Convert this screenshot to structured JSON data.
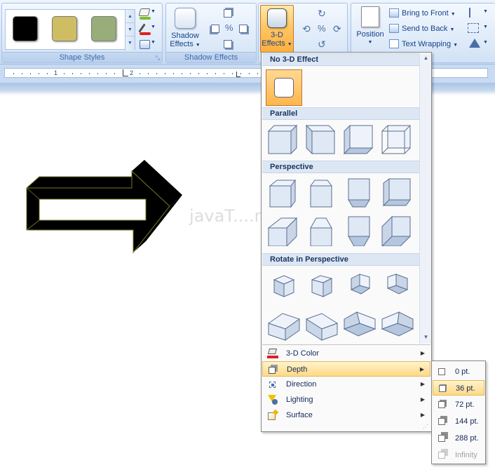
{
  "ribbon": {
    "shape_styles": {
      "label": "Shape Styles",
      "swatches": [
        "#000000",
        "#cfbd63",
        "#98ad7a"
      ]
    },
    "shadow_effects": {
      "button_label_1": "Shadow",
      "button_label_2": "Effects",
      "group_label": "Shadow Effects"
    },
    "three_d": {
      "button_label_1": "3-D",
      "button_label_2": "Effects"
    },
    "arrange": {
      "position_label": "Position",
      "bring_to_front": "Bring to Front",
      "send_to_back": "Send to Back",
      "text_wrapping": "Text Wrapping"
    }
  },
  "ruler": {
    "numbers": [
      "1",
      "1",
      "2"
    ]
  },
  "dropdown": {
    "no_effect_header": "No 3-D Effect",
    "parallel_header": "Parallel",
    "perspective_header": "Perspective",
    "rotate_header": "Rotate in Perspective",
    "menu": {
      "color": "3-D Color",
      "depth": "Depth",
      "direction": "Direction",
      "lighting": "Lighting",
      "surface": "Surface"
    },
    "accent_color": "#ffc766"
  },
  "depth_submenu": {
    "items": [
      "0 pt.",
      "36 pt.",
      "72 pt.",
      "144 pt.",
      "288 pt.",
      "Infinity"
    ]
  },
  "watermark": "javaT....m"
}
